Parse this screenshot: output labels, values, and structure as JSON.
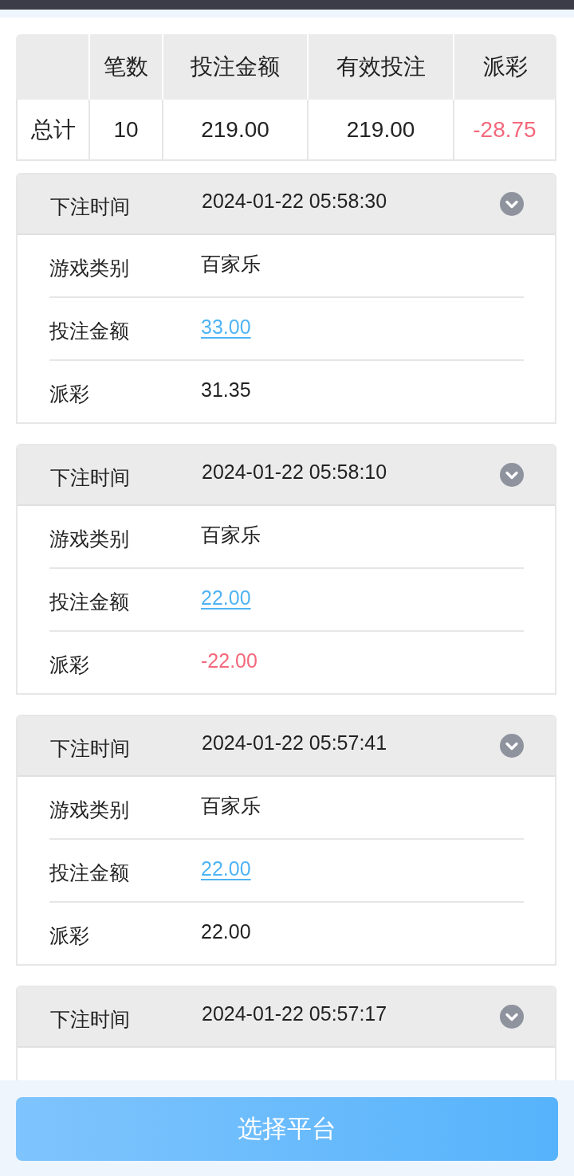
{
  "summary": {
    "columns": [
      "笔数",
      "投注金额",
      "有效投注",
      "派彩"
    ],
    "rows": [
      {
        "label": "总计",
        "cells": [
          {
            "text": "10",
            "negative": false
          },
          {
            "text": "219.00",
            "negative": false
          },
          {
            "text": "219.00",
            "negative": false
          },
          {
            "text": "-28.75",
            "negative": true
          }
        ]
      }
    ]
  },
  "bets": [
    {
      "time_label": "下注时间",
      "time": "2024-01-22 05:58:30",
      "details": [
        {
          "label": "游戏类别",
          "value": "百家乐",
          "kind": "text",
          "negative": false
        },
        {
          "label": "投注金额",
          "value": "33.00",
          "kind": "link",
          "negative": false
        },
        {
          "label": "派彩",
          "value": "31.35",
          "kind": "text",
          "negative": false
        }
      ]
    },
    {
      "time_label": "下注时间",
      "time": "2024-01-22 05:58:10",
      "details": [
        {
          "label": "游戏类别",
          "value": "百家乐",
          "kind": "text",
          "negative": false
        },
        {
          "label": "投注金额",
          "value": "22.00",
          "kind": "link",
          "negative": false
        },
        {
          "label": "派彩",
          "value": "-22.00",
          "kind": "text",
          "negative": true
        }
      ]
    },
    {
      "time_label": "下注时间",
      "time": "2024-01-22 05:57:41",
      "details": [
        {
          "label": "游戏类别",
          "value": "百家乐",
          "kind": "text",
          "negative": false
        },
        {
          "label": "投注金额",
          "value": "22.00",
          "kind": "link",
          "negative": false
        },
        {
          "label": "派彩",
          "value": "22.00",
          "kind": "text",
          "negative": false
        }
      ]
    },
    {
      "time_label": "下注时间",
      "time": "2024-01-22 05:57:17"
    }
  ],
  "footer": {
    "button": "选择平台"
  }
}
